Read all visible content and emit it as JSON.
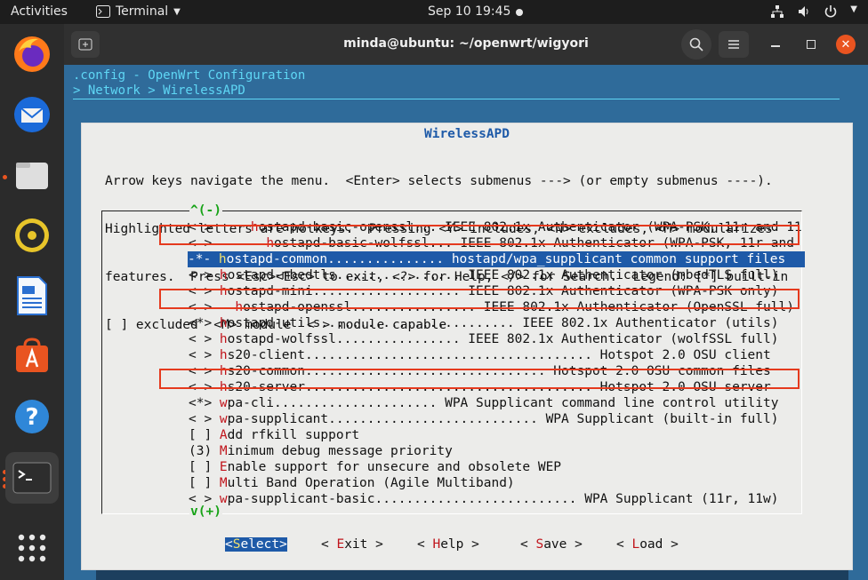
{
  "topbar": {
    "activities": "Activities",
    "app_name": "Terminal",
    "clock": "Sep 10  19:45"
  },
  "window": {
    "title": "minda@ubuntu: ~/openwrt/wigyori"
  },
  "terminal": {
    "config_title": ".config - OpenWrt Configuration",
    "breadcrumb": "> Network > WirelessAPD"
  },
  "dialog": {
    "title": "WirelessAPD",
    "help_lines": [
      "Arrow keys navigate the menu.  <Enter> selects submenus ---> (or empty submenus ----).",
      "Highlighted letters are hotkeys.  Pressing <Y> includes, <N> excludes, <M> modularizes",
      "features.  Press <Esc><Esc> to exit, <?> for Help, </> for Search.  Legend: [*] built-in",
      "[ ] excluded  <M> module  < > module capable"
    ],
    "scroll_up": "^(-)",
    "scroll_down": "v(+)",
    "items": [
      {
        "prefix": "< >     ",
        "hk": "h",
        "rest": "ostapd-basic-openssl... IEEE 802.1x Authenticator (WPA-PSK, 11r and 11"
      },
      {
        "prefix": "< >       ",
        "hk": "h",
        "rest": "ostapd-basic-wolfssl... IEEE 802.1x Authenticator (WPA-PSK, 11r and"
      },
      {
        "prefix": "-*- ",
        "hk": "h",
        "rest": "ostapd-common............... hostapd/wpa_supplicant common support files"
      },
      {
        "prefix": "< > ",
        "hk": "h",
        "rest": "ostapd-mbedtls................ IEEE 802.1x Authenticator (mbedTLS full)"
      },
      {
        "prefix": "< > ",
        "hk": "h",
        "rest": "ostapd-mini................... IEEE 802.1x Authenticator (WPA-PSK only)"
      },
      {
        "prefix": "< >   ",
        "hk": "h",
        "rest": "ostapd-openssl................ IEEE 802.1x Authenticator (OpenSSL full)"
      },
      {
        "prefix": "<*> ",
        "hk": "h",
        "rest": "ostapd-utils......................... IEEE 802.1x Authenticator (utils)"
      },
      {
        "prefix": "< > ",
        "hk": "h",
        "rest": "ostapd-wolfssl................ IEEE 802.1x Authenticator (wolfSSL full)"
      },
      {
        "prefix": "< > ",
        "hk": "h",
        "rest": "s20-client..................................... Hotspot 2.0 OSU client"
      },
      {
        "prefix": "< > ",
        "hk": "h",
        "rest": "s20-common............................... Hotspot 2.0 OSU common files"
      },
      {
        "prefix": "< > ",
        "hk": "h",
        "rest": "s20-server..................................... Hotspot 2.0 OSU server"
      },
      {
        "prefix": "<*> ",
        "hk": "w",
        "rest": "pa-cli..................... WPA Supplicant command line control utility"
      },
      {
        "prefix": "< > ",
        "hk": "w",
        "rest": "pa-supplicant........................... WPA Supplicant (built-in full)"
      },
      {
        "prefix": "[ ] ",
        "hk": "A",
        "rest": "dd rfkill support"
      },
      {
        "prefix": "(3) ",
        "hk": "M",
        "rest": "inimum debug message priority"
      },
      {
        "prefix": "[ ] ",
        "hk": "E",
        "rest": "nable support for unsecure and obsolete WEP"
      },
      {
        "prefix": "[ ] ",
        "hk": "M",
        "rest": "ulti Band Operation (Agile Multiband)"
      },
      {
        "prefix": "< > ",
        "hk": "w",
        "rest": "pa-supplicant-basic.......................... WPA Supplicant (11r, 11w)"
      }
    ],
    "buttons": [
      {
        "pre": "<",
        "hk": "S",
        "post": "elect>"
      },
      {
        "pre": "< ",
        "hk": "E",
        "post": "xit >"
      },
      {
        "pre": "< ",
        "hk": "H",
        "post": "elp >"
      },
      {
        "pre": "< ",
        "hk": "S",
        "post": "ave >"
      },
      {
        "pre": "< ",
        "hk": "L",
        "post": "oad >"
      }
    ]
  },
  "colors": {
    "annotation_box": "#e53a1e",
    "selected_bg": "#1e5aa8",
    "terminal_bg": "#2f6b9a"
  }
}
